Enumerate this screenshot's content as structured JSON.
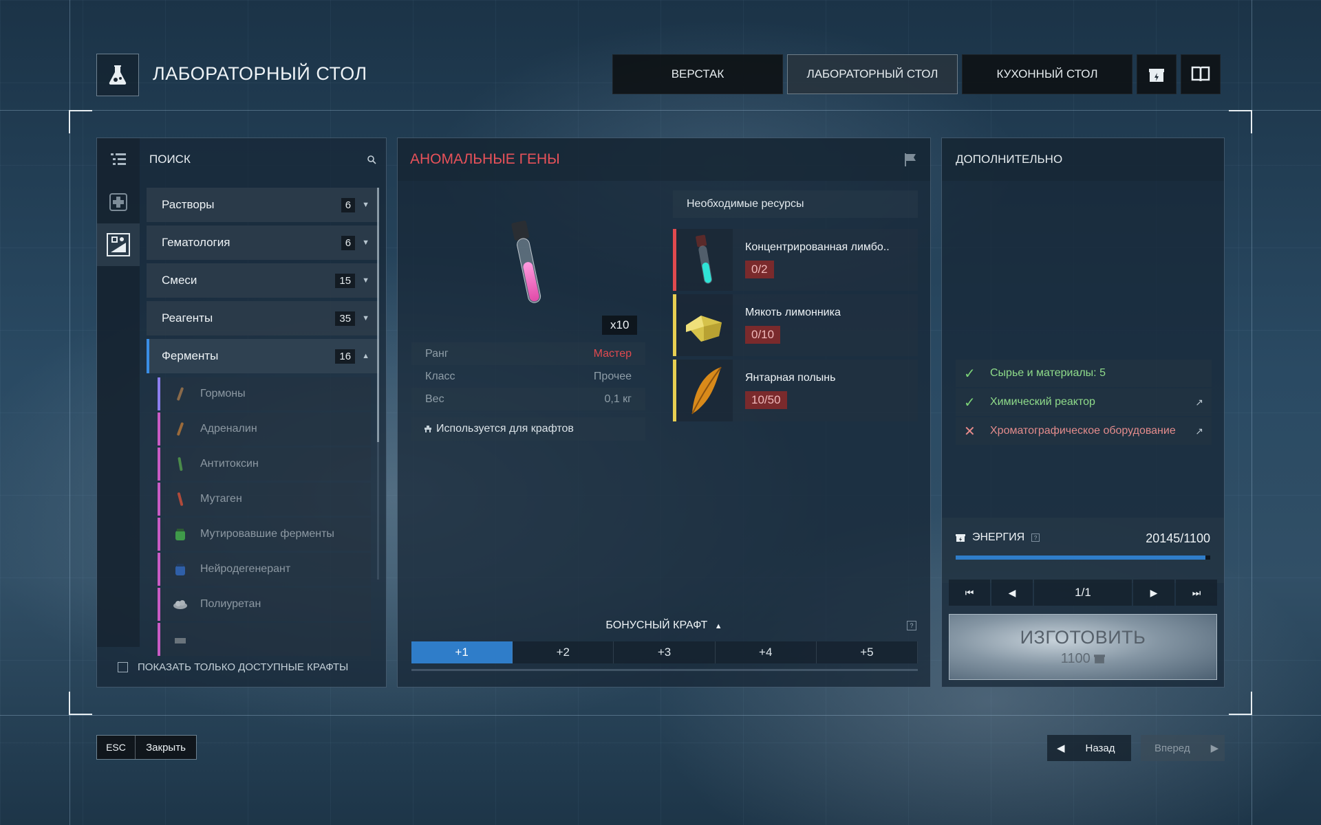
{
  "header": {
    "title": "ЛАБОРАТОРНЫЙ СТОЛ",
    "tabs": [
      {
        "label": "ВЕРСТАК",
        "active": false
      },
      {
        "label": "ЛАБОРАТОРНЫЙ СТОЛ",
        "active": true
      },
      {
        "label": "КУХОННЫЙ СТОЛ",
        "active": false
      }
    ],
    "icons": [
      "energy-gift-icon",
      "book-icon"
    ]
  },
  "left_panel": {
    "search_label": "ПОИСК",
    "categories": [
      {
        "name": "Растворы",
        "count": "6",
        "expanded": false
      },
      {
        "name": "Гематология",
        "count": "6",
        "expanded": false
      },
      {
        "name": "Смеси",
        "count": "15",
        "expanded": false
      },
      {
        "name": "Реагенты",
        "count": "35",
        "expanded": false
      },
      {
        "name": "Ферменты",
        "count": "16",
        "expanded": true
      }
    ],
    "subitems": [
      {
        "name": "Гормоны",
        "bar_color": "#8c7ff0"
      },
      {
        "name": "Адреналин",
        "bar_color": "#c95bc4"
      },
      {
        "name": "Антитоксин",
        "bar_color": "#c95bc4"
      },
      {
        "name": "Мутаген",
        "bar_color": "#c95bc4"
      },
      {
        "name": "Мутировавшие ферменты",
        "bar_color": "#c95bc4"
      },
      {
        "name": "Нейродегенерант",
        "bar_color": "#c95bc4"
      },
      {
        "name": "Полиуретан",
        "bar_color": "#c95bc4"
      },
      {
        "name": "",
        "bar_color": "#c95bc4"
      }
    ],
    "show_available_label": "ПОКАЗАТЬ ТОЛЬКО ДОСТУПНЫЕ КРАФТЫ"
  },
  "recipe": {
    "title": "АНОМАЛЬНЫЕ ГЕНЫ",
    "quantity": "x10",
    "stats": [
      {
        "label": "Ранг",
        "value": "Мастер"
      },
      {
        "label": "Класс",
        "value": "Прочее"
      },
      {
        "label": "Вес",
        "value": "0,1 кг"
      }
    ],
    "used_for": "Используется для крафтов",
    "resources_title": "Необходимые ресурсы",
    "resources": [
      {
        "name": "Концентрированная лимбо..",
        "count": "0/2",
        "bar_color": "#e14a4f"
      },
      {
        "name": "Мякоть лимонника",
        "count": "0/10",
        "bar_color": "#e8cf52"
      },
      {
        "name": "Янтарная полынь",
        "count": "10/50",
        "bar_color": "#e8cf52"
      }
    ],
    "bonus_label": "БОНУСНЫЙ КРАФТ",
    "bonus_tabs": [
      "+1",
      "+2",
      "+3",
      "+4",
      "+5"
    ]
  },
  "right_panel": {
    "title": "ДОПОЛНИТЕЛЬНО",
    "requirements": [
      {
        "label": "Сырье и материалы: 5",
        "status": "ok"
      },
      {
        "label": "Химический реактор",
        "status": "ok"
      },
      {
        "label": "Хроматографическое оборудование",
        "status": "fail"
      }
    ],
    "energy_label": "ЭНЕРГИЯ",
    "energy_value": "20145/1100",
    "energy_fraction": 0.98,
    "page": "1/1",
    "make_label": "ИЗГОТОВИТЬ",
    "make_cost": "1100"
  },
  "footer": {
    "esc_key": "ESC",
    "close_label": "Закрыть",
    "back_label": "Назад",
    "forward_label": "Вперед"
  }
}
